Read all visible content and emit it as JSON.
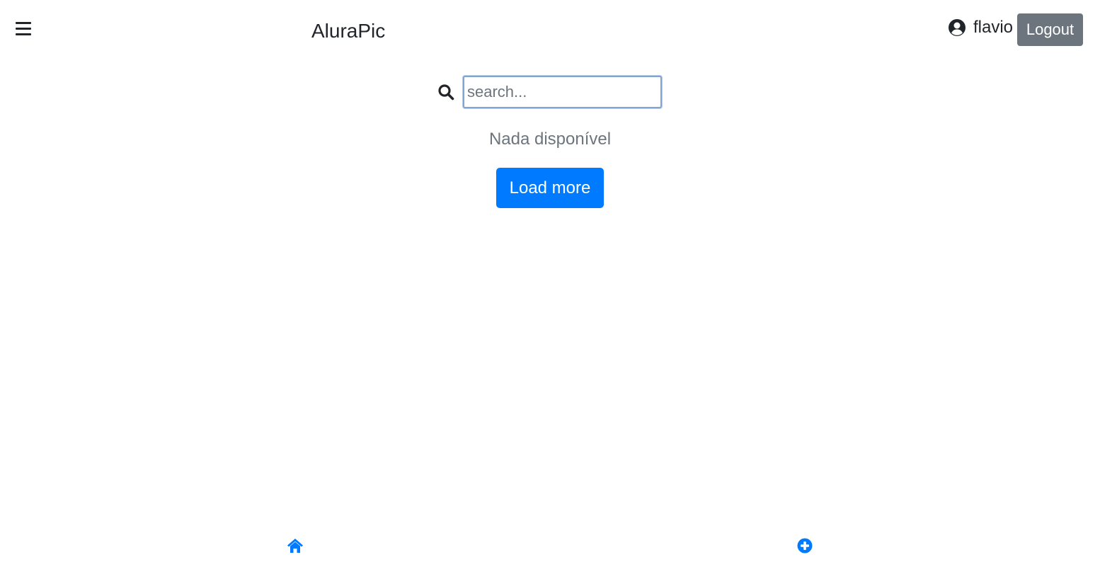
{
  "header": {
    "brand": "AluraPic",
    "user_name": "flavio",
    "logout_label": "Logout",
    "menu_icon": "hamburger-menu-icon",
    "user_icon": "user-circle-icon"
  },
  "search": {
    "placeholder": "search...",
    "value": "",
    "icon": "search-icon"
  },
  "main": {
    "empty_message": "Nada disponível",
    "load_more_label": "Load more"
  },
  "footer": {
    "home_icon": "home-icon",
    "add_icon": "plus-circle-icon"
  },
  "colors": {
    "primary": "#007bff",
    "secondary": "#6c757d",
    "text": "#212529",
    "muted": "#6c757d"
  }
}
